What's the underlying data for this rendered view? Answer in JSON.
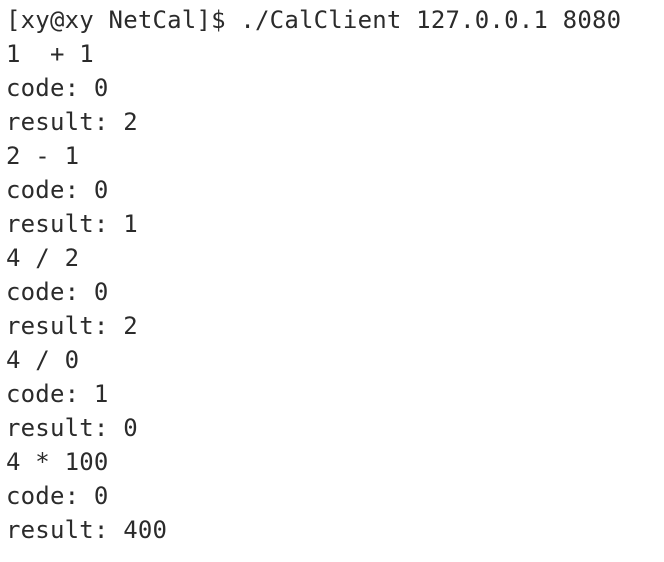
{
  "terminal": {
    "lines": [
      "[xy@xy NetCal]$ ./CalClient 127.0.0.1 8080",
      "1  + 1",
      "code: 0",
      "result: 2",
      "2 - 1",
      "code: 0",
      "result: 1",
      "4 / 2",
      "code: 0",
      "result: 2",
      "4 / 0",
      "code: 1",
      "result: 0",
      "4 * 100",
      "code: 0",
      "result: 400"
    ]
  }
}
